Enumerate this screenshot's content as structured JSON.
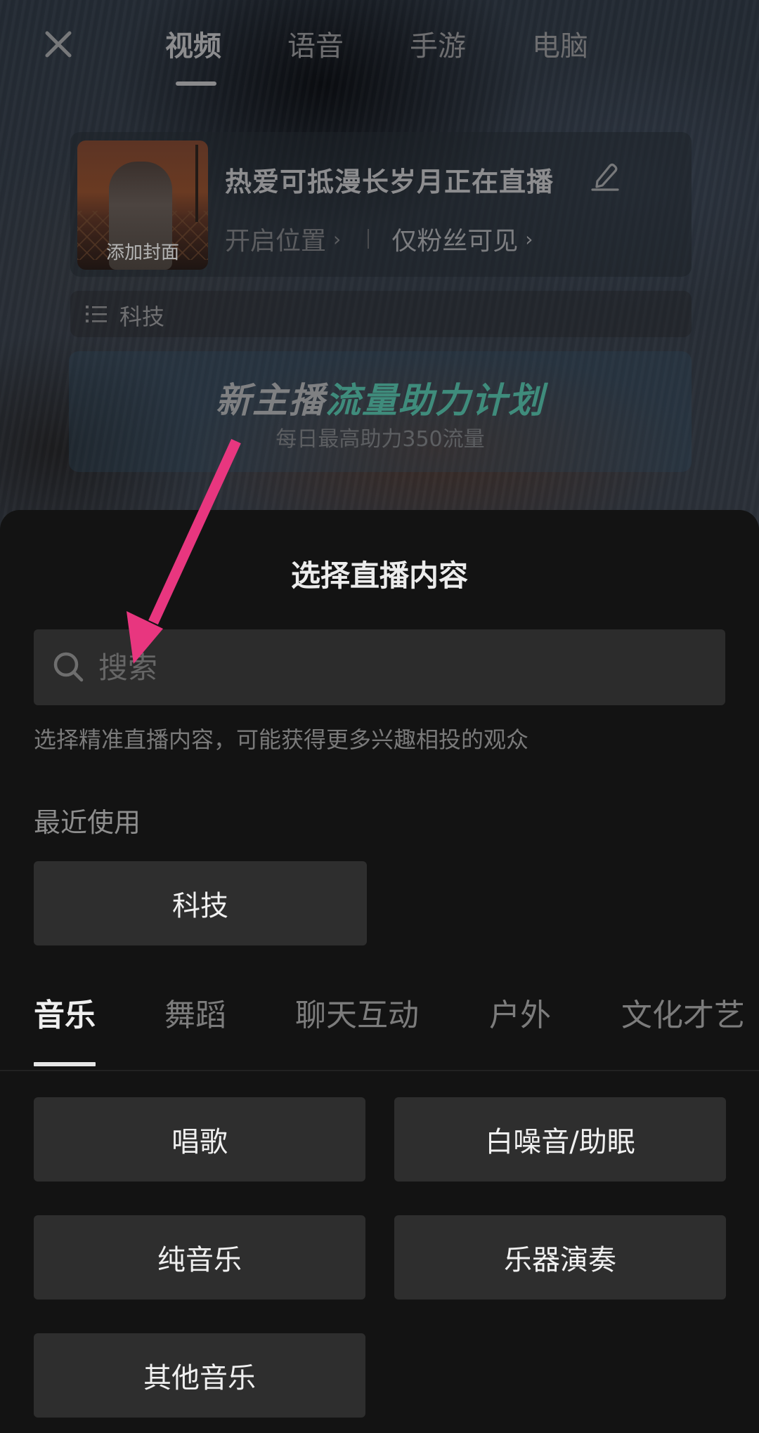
{
  "top_bar": {
    "close_icon": "close-icon",
    "mode_tabs": [
      {
        "label": "视频",
        "active": true
      },
      {
        "label": "语音",
        "active": false
      },
      {
        "label": "手游",
        "active": false
      },
      {
        "label": "电脑",
        "active": false
      }
    ]
  },
  "live_info": {
    "cover_label": "添加封面",
    "title": "热爱可抵漫长岁月正在直播",
    "edit_icon": "pencil-icon",
    "location_label": "开启位置",
    "visibility_label": "仅粉丝可见",
    "chevron": "›"
  },
  "category_row": {
    "icon": "list-icon",
    "label": "科技"
  },
  "promo": {
    "title_part1": "新主播",
    "title_part2": "流量助力计划",
    "subtitle": "每日最高助力350流量",
    "accent_color": "#3f8c7c"
  },
  "sheet": {
    "title": "选择直播内容",
    "search": {
      "placeholder": "搜索",
      "value": ""
    },
    "hint": "选择精准直播内容，可能获得更多兴趣相投的观众",
    "recent_label": "最近使用",
    "recent_items": [
      "科技"
    ],
    "category_tabs": [
      {
        "label": "音乐",
        "active": true
      },
      {
        "label": "舞蹈",
        "active": false
      },
      {
        "label": "聊天互动",
        "active": false
      },
      {
        "label": "户外",
        "active": false
      },
      {
        "label": "文化才艺",
        "active": false
      }
    ],
    "music_items": [
      "唱歌",
      "白噪音/助眠",
      "纯音乐",
      "乐器演奏",
      "其他音乐"
    ]
  },
  "annotation": {
    "arrow_color": "#e8367f",
    "points_to": "search-input"
  }
}
